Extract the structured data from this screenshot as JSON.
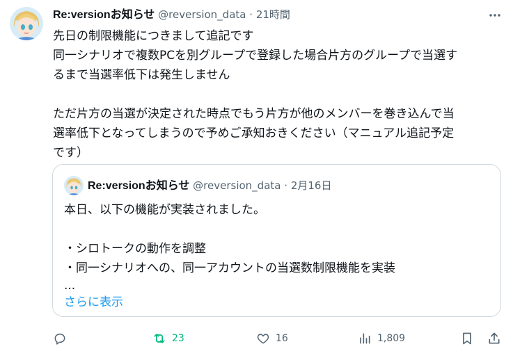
{
  "tweet": {
    "author_name": "Re:versionお知らせ",
    "handle": "@reversion_data",
    "separator": "·",
    "time": "21時間",
    "lines": [
      "先日の制限機能につきまして追記です",
      "同一シナリオで複数PCを別グループで登録した場合片方のグループで当選す",
      "るまで当選率低下は発生しません",
      "",
      "ただ片方の当選が決定された時点でもう片方が他のメンバーを巻き込んで当",
      "選率低下となってしまうので予めご承知おきください（マニュアル追記予定",
      "です）"
    ]
  },
  "quote": {
    "author_name": "Re:versionお知らせ",
    "handle": "@reversion_data",
    "separator": "·",
    "date": "2月16日",
    "lines": [
      "本日、以下の機能が実装されました。",
      "",
      "・シロトークの動作を調整",
      "・同一シナリオへの、同一アカウントの当選数制限機能を実装",
      "..."
    ],
    "show_more": "さらに表示"
  },
  "actions": {
    "reply_icon": "reply-icon",
    "retweet_icon": "retweet-icon",
    "retweet_count": "23",
    "like_icon": "heart-icon",
    "like_count": "16",
    "views_icon": "views-icon",
    "views_count": "1,809",
    "bookmark_icon": "bookmark-icon",
    "share_icon": "share-icon"
  },
  "colors": {
    "text": "#0f1419",
    "muted": "#536471",
    "link": "#1d9bf0",
    "retweet": "#00ba7c",
    "border": "#cfd9de"
  }
}
